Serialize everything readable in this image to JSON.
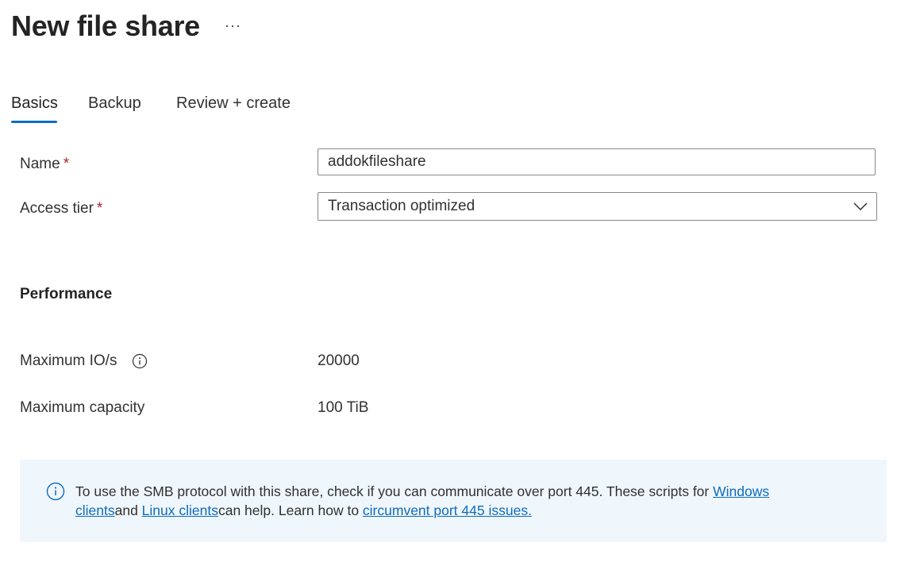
{
  "header": {
    "title": "New file share",
    "more_label": "···"
  },
  "tabs": [
    {
      "label": "Basics",
      "selected": true
    },
    {
      "label": "Backup",
      "selected": false
    },
    {
      "label": "Review + create",
      "selected": false
    }
  ],
  "form": {
    "name_label": "Name",
    "name_required": "*",
    "name_value": "addokfileshare",
    "access_tier_label": "Access tier",
    "access_tier_required": "*",
    "access_tier_value": "Transaction optimized"
  },
  "performance": {
    "heading": "Performance",
    "max_iops_label": "Maximum IO/s",
    "max_iops_value": "20000",
    "max_capacity_label": "Maximum capacity",
    "max_capacity_value": "100 TiB"
  },
  "banner": {
    "text_1": "To use the SMB protocol with this share, check if you can communicate over port 445. These scripts for ",
    "link_windows": "Windows clients",
    "text_2": "and ",
    "link_linux": "Linux clients",
    "text_3": "can help. Learn how to ",
    "link_circumvent": "circumvent port 445 issues."
  },
  "colors": {
    "accent": "#0f6cbd",
    "required": "#a4262c",
    "banner_bg": "#eff6fc"
  },
  "icons": {
    "more": "ellipsis-icon",
    "dropdown": "chevron-down-icon",
    "info": "info-icon"
  }
}
